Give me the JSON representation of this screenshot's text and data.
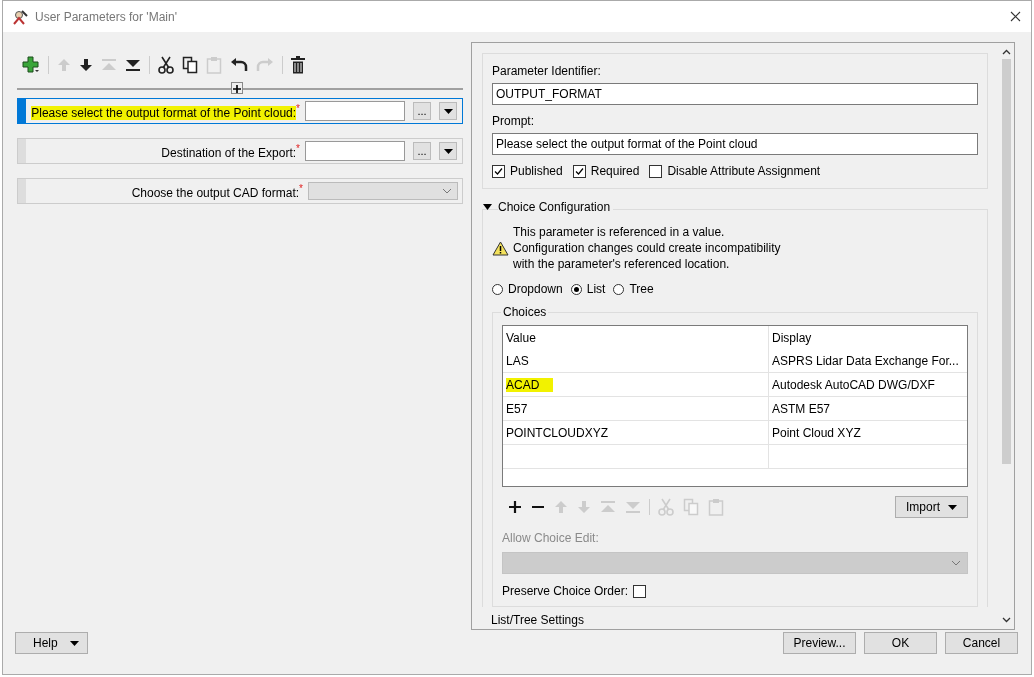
{
  "window": {
    "title": "User Parameters for 'Main'"
  },
  "toolbar": {
    "groups": [
      [
        {
          "kind": "add",
          "disabled": false
        }
      ],
      [
        {
          "kind": "up",
          "disabled": true
        },
        {
          "kind": "down",
          "disabled": false
        },
        {
          "kind": "top",
          "disabled": true
        },
        {
          "kind": "bottom",
          "disabled": false
        }
      ],
      [
        {
          "kind": "cut",
          "disabled": false
        },
        {
          "kind": "copy",
          "disabled": false
        },
        {
          "kind": "paste",
          "disabled": true
        },
        {
          "kind": "undo",
          "disabled": false
        },
        {
          "kind": "redo",
          "disabled": true
        }
      ],
      [
        {
          "kind": "delete",
          "disabled": false
        }
      ]
    ]
  },
  "parameters": [
    {
      "kind": "file",
      "label": "Please select the output format of the Point cloud:",
      "marker": "*",
      "selected": true,
      "highlighted": true,
      "browse": "..."
    },
    {
      "kind": "file",
      "label": "Destination of the Export:",
      "marker": "*",
      "selected": false,
      "highlighted": false,
      "browse": "..."
    },
    {
      "kind": "choice",
      "label": "Choose the output CAD format:",
      "marker": "*",
      "selected": false,
      "highlighted": false
    }
  ],
  "editor": {
    "identifier_label": "Parameter Identifier:",
    "identifier": "OUTPUT_FORMAT",
    "prompt_label": "Prompt:",
    "prompt": "Please select the output format of the Point cloud",
    "options": [
      {
        "label": "Published",
        "checked": true
      },
      {
        "label": "Required",
        "checked": true
      },
      {
        "label": "Disable Attribute Assignment",
        "checked": false
      }
    ],
    "choice_configuration": {
      "title": "Choice Configuration",
      "expanded": true,
      "warning": "This parameter is referenced in a value.\nConfiguration changes could create incompatibility\nwith the parameter's referenced location.",
      "modes": [
        {
          "label": "Dropdown",
          "selected": false
        },
        {
          "label": "List",
          "selected": true
        },
        {
          "label": "Tree",
          "selected": false
        }
      ],
      "choices": {
        "title": "Choices",
        "columns": [
          "Value",
          "Display"
        ],
        "rows": [
          {
            "value": "LAS",
            "display": "ASPRS Lidar Data Exchange For...",
            "highlighted": false
          },
          {
            "value": "ACAD",
            "display": "Autodesk AutoCAD DWG/DXF",
            "highlighted": true
          },
          {
            "value": "E57",
            "display": "ASTM E57",
            "highlighted": false
          },
          {
            "value": "POINTCLOUDXYZ",
            "display": "Point Cloud XYZ",
            "highlighted": false
          }
        ],
        "toolbar": [
          [
            {
              "kind": "plus",
              "disabled": false
            },
            {
              "kind": "remove",
              "disabled": false
            },
            {
              "kind": "up",
              "disabled": true
            },
            {
              "kind": "down",
              "disabled": true
            },
            {
              "kind": "top",
              "disabled": true
            },
            {
              "kind": "bottom",
              "disabled": true
            }
          ],
          [
            {
              "kind": "cut",
              "disabled": true
            },
            {
              "kind": "copy",
              "disabled": true
            },
            {
              "kind": "paste",
              "disabled": true
            }
          ]
        ],
        "import_button": "Import"
      },
      "allow_choice_edit": {
        "label": "Allow Choice Edit:",
        "disabled": true
      },
      "preserve_order": {
        "label": "Preserve Choice Order:",
        "checked": false
      }
    },
    "next_section": "List/Tree Settings"
  },
  "footer": {
    "help": "Help",
    "preview": "Preview...",
    "ok": "OK",
    "cancel": "Cancel"
  }
}
